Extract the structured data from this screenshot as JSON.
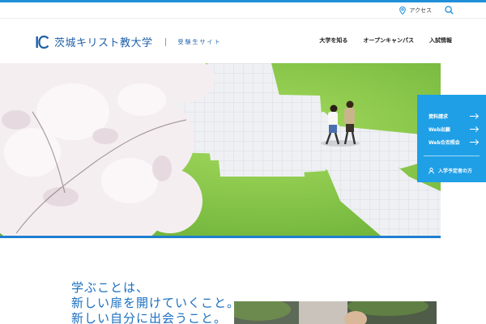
{
  "header": {
    "utility": {
      "access_label": "アクセス"
    },
    "logo": {
      "name": "茨城キリスト教大学",
      "sub": "受験生サイト"
    },
    "nav": [
      {
        "label": "大学を知る"
      },
      {
        "label": "オープンキャンパス"
      },
      {
        "label": "入試情報"
      }
    ]
  },
  "side_menu": {
    "items": [
      {
        "label": "資料請求"
      },
      {
        "label": "Web出願"
      },
      {
        "label": "Web合否照会"
      }
    ],
    "exam_label": "入学予定者の方"
  },
  "catch": {
    "lines": [
      "学ぶことは、",
      "新しい扉を開けていくこと。",
      "新しい自分に出会うこと。"
    ]
  },
  "colors": {
    "brand_blue": "#1f5fa8",
    "accent_blue": "#1f9fe6",
    "catch_blue": "#1a6fc0"
  }
}
